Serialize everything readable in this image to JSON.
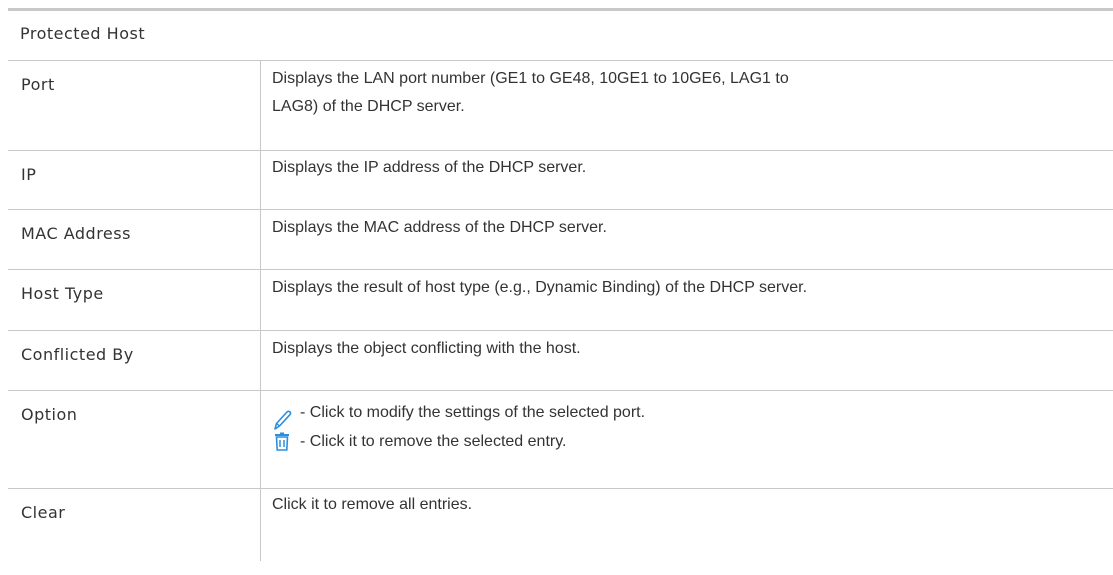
{
  "section_title": "Protected Host",
  "rows": [
    {
      "term": "Port",
      "desc_line1": "Displays the LAN port number (GE1 to GE48, 10GE1 to 10GE6, LAG1 to",
      "desc_line2": "LAG8) of the DHCP server."
    },
    {
      "term": "IP",
      "desc": "Displays the IP address of the DHCP server."
    },
    {
      "term": "MAC Address",
      "desc": "Displays the MAC address of the DHCP server."
    },
    {
      "term": "Host Type",
      "desc": "Displays the result of host type (e.g., Dynamic Binding) of the DHCP server."
    },
    {
      "term": "Conflicted By",
      "desc": "Displays the object conflicting with the host."
    },
    {
      "term": "Option",
      "items": [
        {
          "icon": "pencil-icon",
          "text": "- Click to modify the settings of the selected port."
        },
        {
          "icon": "trash-icon",
          "text": "- Click it to remove the selected entry."
        }
      ]
    },
    {
      "term": "Clear",
      "desc": "Click it to remove all entries."
    }
  ],
  "colors": {
    "border": "#c8c8c8",
    "text": "#333333",
    "icon_blue": "#2a8fe0"
  }
}
